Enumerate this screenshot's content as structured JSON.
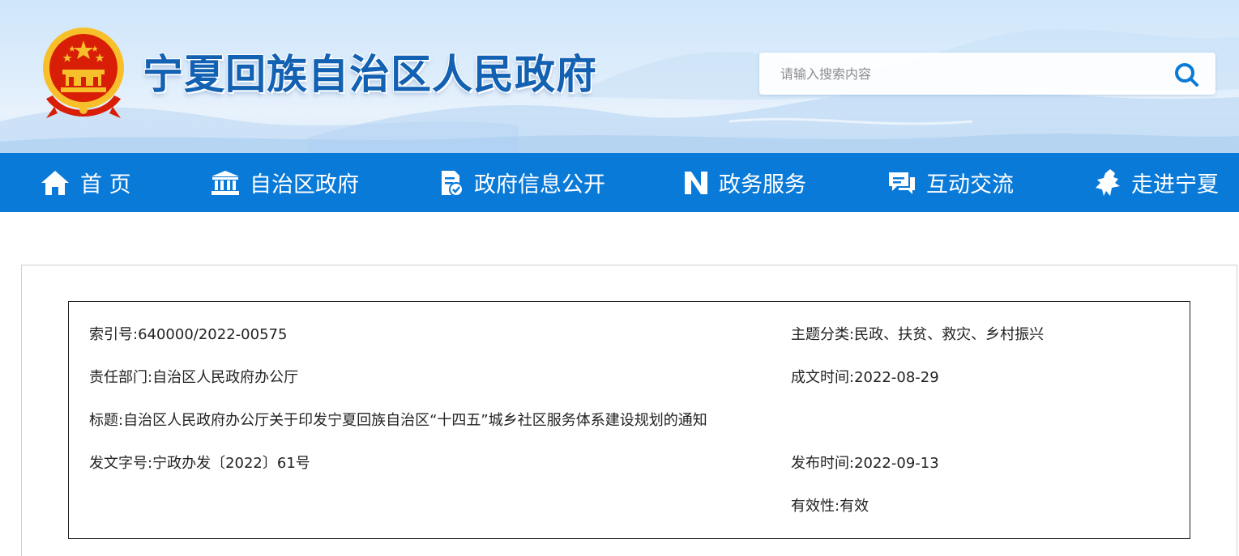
{
  "header": {
    "site_title": "宁夏回族自治区人民政府",
    "search": {
      "placeholder": "请输入搜索内容",
      "value": ""
    }
  },
  "icons": {
    "emblem": "national-emblem",
    "search": "search-icon",
    "home": "home-icon",
    "government": "government-building-icon",
    "info": "document-check-icon",
    "service": "service-n-icon",
    "interaction": "chat-bubbles-icon",
    "about": "ningxia-map-icon"
  },
  "nav": {
    "items": [
      {
        "label": "首 页"
      },
      {
        "label": "自治区政府"
      },
      {
        "label": "政府信息公开"
      },
      {
        "label": "政务服务"
      },
      {
        "label": "互动交流"
      },
      {
        "label": "走进宁夏"
      }
    ]
  },
  "info": {
    "index_label": "索引号:",
    "index_value": "640000/2022-00575",
    "topic_label": "主题分类:",
    "topic_value": "民政、扶贫、救灾、乡村振兴",
    "dept_label": "责任部门:",
    "dept_value": "自治区人民政府办公厅",
    "created_label": "成文时间:",
    "created_value": "2022-08-29",
    "title_label": "标题:",
    "title_value": "自治区人民政府办公厅关于印发宁夏回族自治区“十四五”城乡社区服务体系建设规划的通知",
    "docno_label": "发文字号:",
    "docno_value": "宁政办发〔2022〕61号",
    "published_label": "发布时间:",
    "published_value": "2022-09-13",
    "validity_label": "有效性:",
    "validity_value": "有效"
  },
  "colors": {
    "nav_bg": "#0a7ad8",
    "title_blue": "#1261b3",
    "emblem_red": "#d81e06",
    "emblem_gold": "#f7c02a"
  }
}
